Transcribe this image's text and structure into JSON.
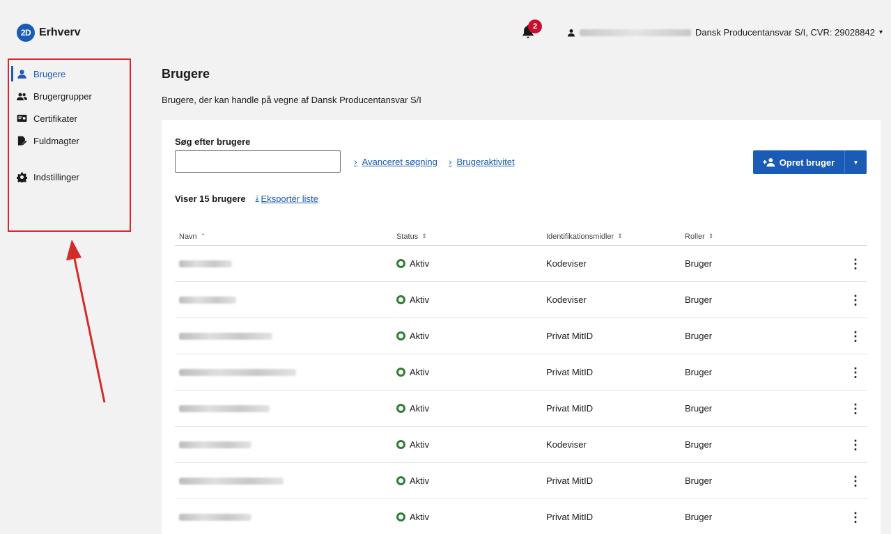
{
  "brand": {
    "logo_text": "2D",
    "name": "Erhverv"
  },
  "header": {
    "notification_count": "2",
    "organization": "Dansk Producentansvar S/I, CVR: 29028842",
    "dropdown_caret": "▾"
  },
  "sidebar": {
    "items": [
      {
        "label": "Brugere",
        "icon": "user-icon",
        "active": true
      },
      {
        "label": "Brugergrupper",
        "icon": "users-group-icon"
      },
      {
        "label": "Certifikater",
        "icon": "certificate-icon"
      },
      {
        "label": "Fuldmagter",
        "icon": "document-edit-icon"
      },
      {
        "label": "Indstillinger",
        "icon": "gear-icon"
      }
    ]
  },
  "page": {
    "title": "Brugere",
    "subtitle": "Brugere, der kan handle på vegne af Dansk Producentansvar S/I"
  },
  "search": {
    "label": "Søg efter brugere",
    "value": "",
    "advanced_link": "Avanceret søgning",
    "activity_link": "Brugeraktivitet"
  },
  "actions": {
    "create_user": "Opret bruger"
  },
  "list": {
    "count_text": "Viser 15 brugere",
    "export_link": "Eksportér liste"
  },
  "table": {
    "headers": [
      "Navn",
      "Status",
      "Identifikationsmidler",
      "Roller"
    ],
    "rows": [
      {
        "status": "Aktiv",
        "ident": "Kodeviser",
        "role": "Bruger"
      },
      {
        "status": "Aktiv",
        "ident": "Kodeviser",
        "role": "Bruger"
      },
      {
        "status": "Aktiv",
        "ident": "Privat MitID",
        "role": "Bruger"
      },
      {
        "status": "Aktiv",
        "ident": "Privat MitID",
        "role": "Bruger"
      },
      {
        "status": "Aktiv",
        "ident": "Privat MitID",
        "role": "Bruger"
      },
      {
        "status": "Aktiv",
        "ident": "Kodeviser",
        "role": "Bruger"
      },
      {
        "status": "Aktiv",
        "ident": "Privat MitID",
        "role": "Bruger"
      },
      {
        "status": "Aktiv",
        "ident": "Privat MitID",
        "role": "Bruger"
      }
    ]
  },
  "colors": {
    "accent": "#1a5bb5",
    "active_status": "#2e7d32",
    "badge": "#c8102e",
    "annotation": "#d42a2a"
  }
}
